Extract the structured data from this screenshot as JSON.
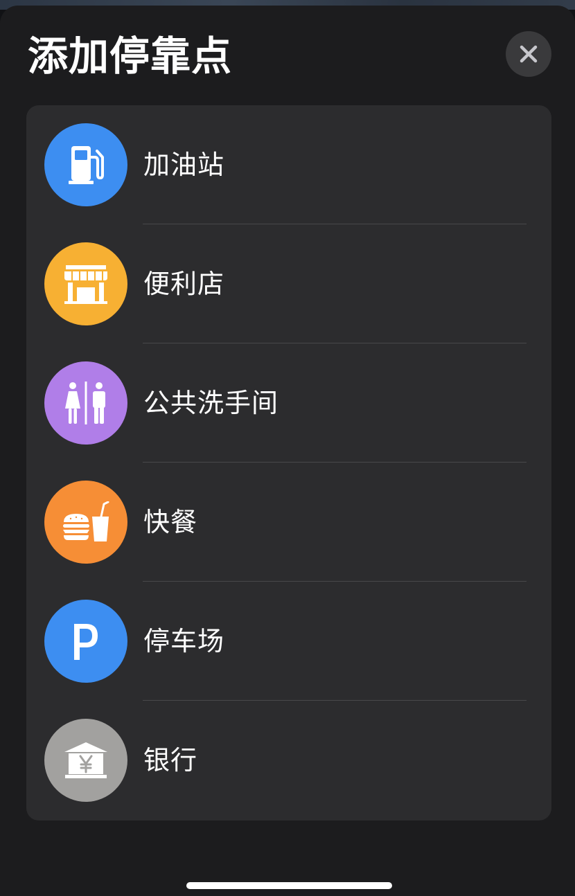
{
  "sheet": {
    "title": "添加停靠点",
    "close_icon": "xmark-icon"
  },
  "stops": [
    {
      "label": "加油站",
      "icon": "fuel-pump-icon",
      "color": "#3d8ef1"
    },
    {
      "label": "便利店",
      "icon": "storefront-icon",
      "color": "#f7b033"
    },
    {
      "label": "公共洗手间",
      "icon": "restroom-icon",
      "color": "#b07ee8"
    },
    {
      "label": "快餐",
      "icon": "burger-drink-icon",
      "color": "#f68e36"
    },
    {
      "label": "停车场",
      "icon": "parking-icon",
      "color": "#3d8ef1"
    },
    {
      "label": "银行",
      "icon": "bank-yen-icon",
      "color": "#a2a19f"
    }
  ]
}
